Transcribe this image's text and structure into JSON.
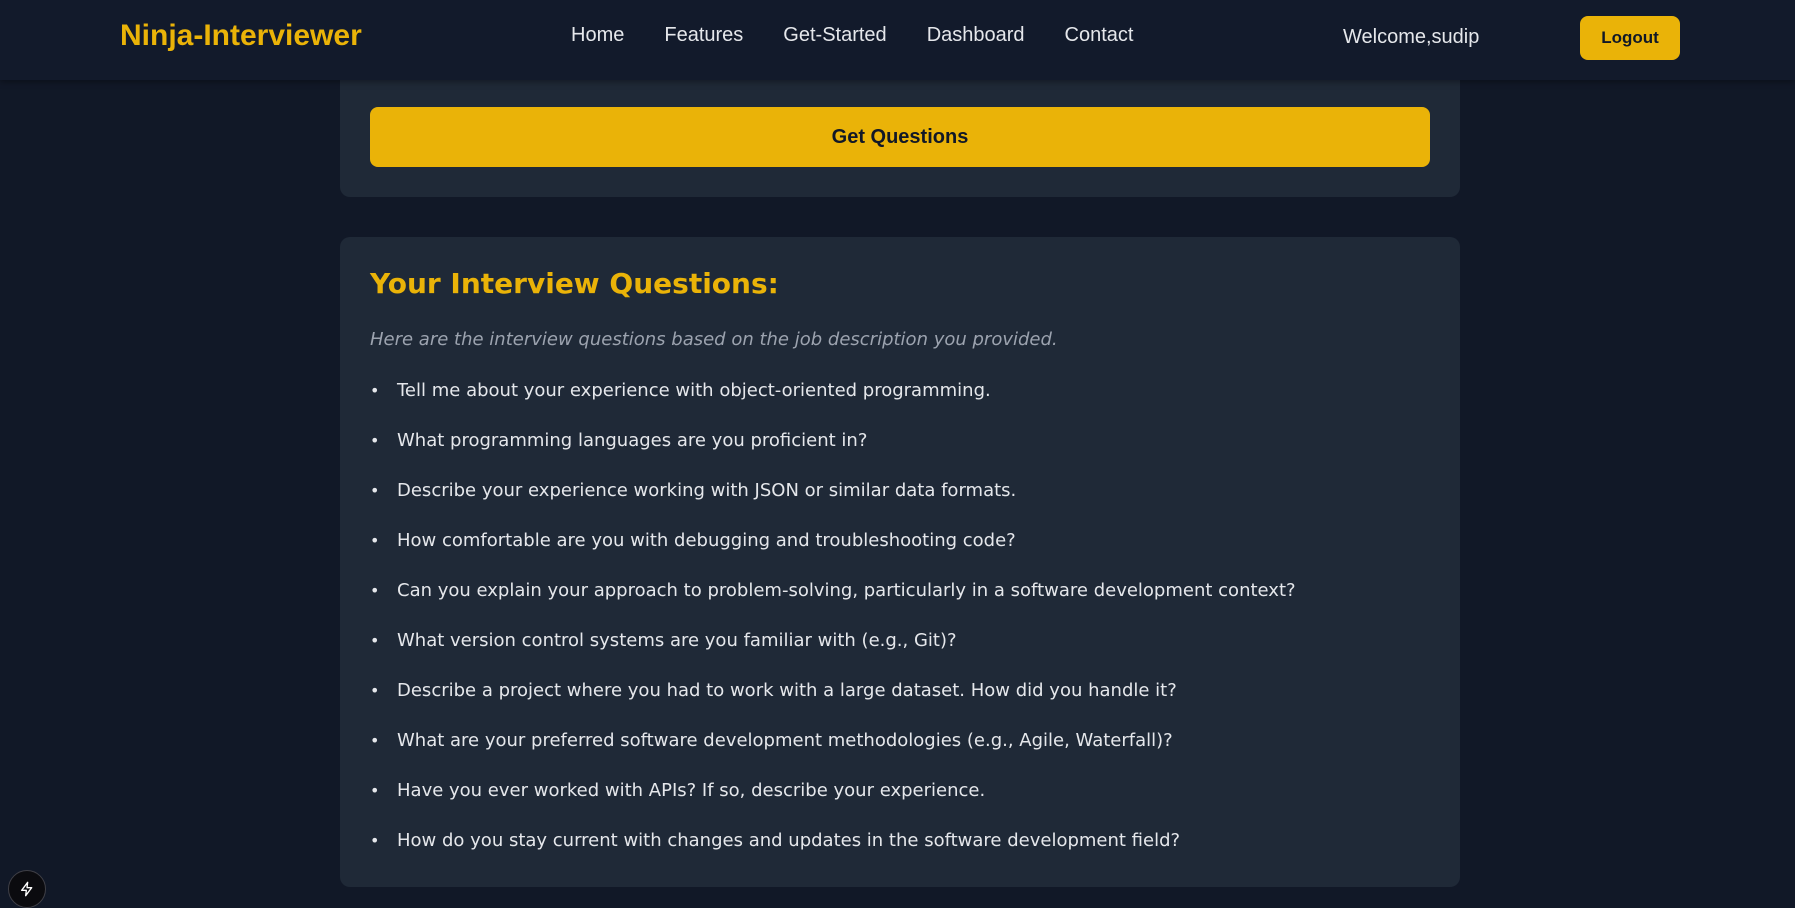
{
  "nav": {
    "brand": "Ninja-Interviewer",
    "links": [
      "Home",
      "Features",
      "Get-Started",
      "Dashboard",
      "Contact"
    ],
    "welcome": "Welcome,sudip",
    "logout_label": "Logout"
  },
  "form": {
    "get_questions_label": "Get Questions"
  },
  "questions": {
    "title": "Your Interview Questions:",
    "subtitle": "Here are the interview questions based on the job description you provided.",
    "bullet": "•",
    "items": [
      "Tell me about your experience with object-oriented programming.",
      "What programming languages are you proficient in?",
      "Describe your experience working with JSON or similar data formats.",
      "How comfortable are you with debugging and troubleshooting code?",
      "Can you explain your approach to problem-solving, particularly in a software development context?",
      "What version control systems are you familiar with (e.g., Git)?",
      "Describe a project where you had to work with a large dataset. How did you handle it?",
      "What are your preferred software development methodologies (e.g., Agile, Waterfall)?",
      "Have you ever worked with APIs? If so, describe your experience.",
      "How do you stay current with changes and updates in the software development field?"
    ]
  },
  "icons": {
    "dev_badge": "lightning-icon"
  },
  "colors": {
    "accent": "#eab308",
    "background": "#111827",
    "card": "#1f2937",
    "text": "#e5e7eb",
    "muted": "#9ca3af"
  }
}
